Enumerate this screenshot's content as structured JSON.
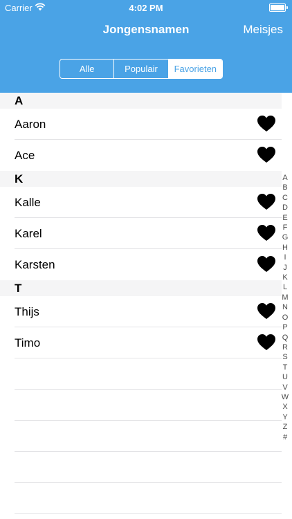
{
  "status_bar": {
    "carrier": "Carrier",
    "time": "4:02 PM"
  },
  "nav": {
    "title": "Jongensnamen",
    "right_button": "Meisjes"
  },
  "segmented": {
    "options": [
      "Alle",
      "Populair",
      "Favorieten"
    ],
    "selected": "Favorieten"
  },
  "sections": [
    {
      "letter": "A",
      "rows": [
        {
          "name": "Aaron",
          "icon": "heart-icon"
        },
        {
          "name": "Ace",
          "icon": "heart-icon"
        }
      ]
    },
    {
      "letter": "K",
      "rows": [
        {
          "name": "Kalle",
          "icon": "heart-icon"
        },
        {
          "name": "Karel",
          "icon": "heart-icon"
        },
        {
          "name": "Karsten",
          "icon": "heart-icon"
        }
      ]
    },
    {
      "letter": "T",
      "rows": [
        {
          "name": "Thijs",
          "icon": "heart-icon"
        },
        {
          "name": "Timo",
          "icon": "heart-icon"
        }
      ]
    }
  ],
  "index_letters": [
    "A",
    "B",
    "C",
    "D",
    "E",
    "F",
    "G",
    "H",
    "I",
    "J",
    "K",
    "L",
    "M",
    "N",
    "O",
    "P",
    "Q",
    "R",
    "S",
    "T",
    "U",
    "V",
    "W",
    "X",
    "Y",
    "Z",
    "#"
  ],
  "colors": {
    "nav_background": "#4aa3e6",
    "section_background": "#f5f5f6",
    "heart": "#000000"
  }
}
